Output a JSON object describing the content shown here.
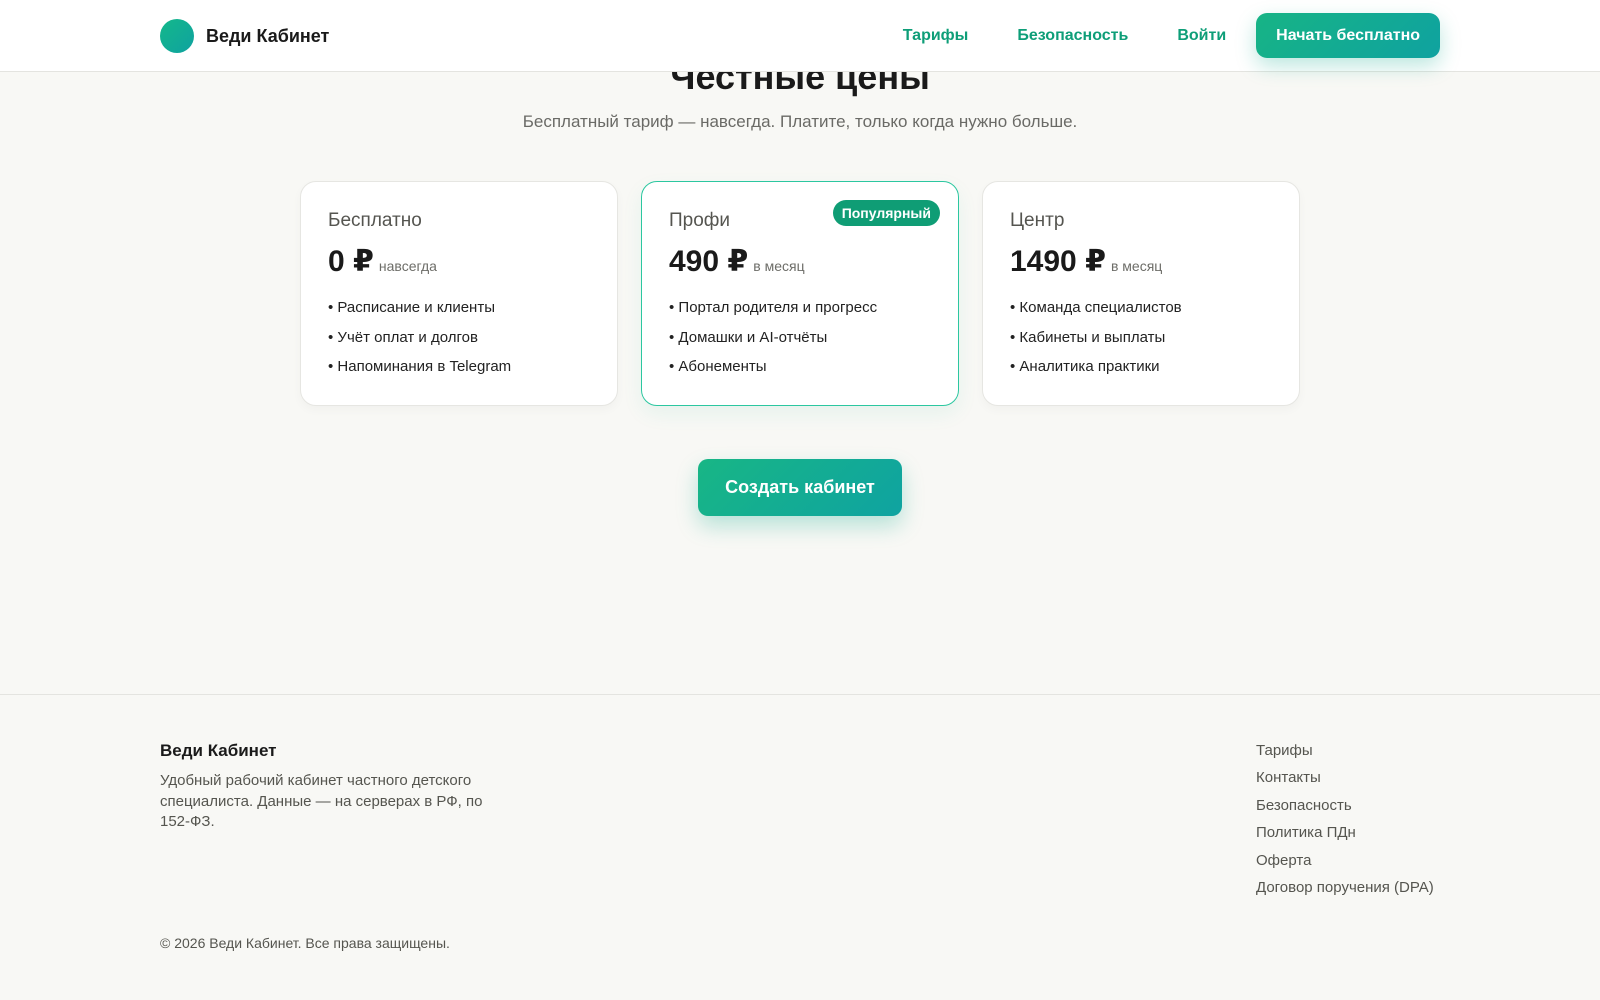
{
  "header": {
    "brand_name": "Веди Кабинет",
    "nav": [
      "Тарифы",
      "Безопасность",
      "Войти"
    ],
    "cta_label": "Начать бесплатно"
  },
  "pricing": {
    "title": "Честные цены",
    "subtitle": "Бесплатный тариф — навсегда. Платите, только когда нужно больше.",
    "plans": [
      {
        "name": "Бесплатно",
        "price": "0 ₽",
        "period": "навсегда",
        "features": [
          "Расписание и клиенты",
          "Учёт оплат и долгов",
          "Напоминания в Telegram"
        ]
      },
      {
        "name": "Профи",
        "price": "490 ₽",
        "period": "в месяц",
        "badge": "Популярный",
        "features": [
          "Портал родителя и прогресс",
          "Домашки и AI-отчёты",
          "Абонементы"
        ]
      },
      {
        "name": "Центр",
        "price": "1490 ₽",
        "period": "в месяц",
        "features": [
          "Команда специалистов",
          "Кабинеты и выплаты",
          "Аналитика практики"
        ]
      }
    ],
    "create_button_label": "Создать кабинет"
  },
  "footer": {
    "brand_name": "Веди Кабинет",
    "description": "Удобный рабочий кабинет частного детского специалиста. Данные — на серверах в РФ, по 152-ФЗ.",
    "links": [
      "Тарифы",
      "Контакты",
      "Безопасность",
      "Политика ПДн",
      "Оферта",
      "Договор поручения (DPA)"
    ],
    "copyright": "© 2026 Веди Кабинет. Все права защищены."
  },
  "colors": {
    "accent": "#0f9d75",
    "accent_gradient_end": "#0fa2a0",
    "background": "#f8f8f5"
  }
}
